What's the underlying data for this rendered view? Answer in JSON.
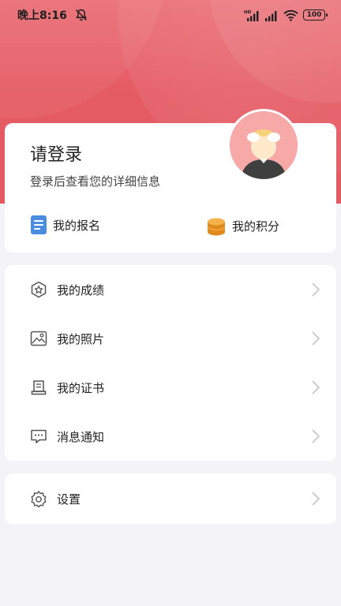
{
  "status_bar": {
    "time": "晚上8:16",
    "battery": "100"
  },
  "profile": {
    "login_title": "请登录",
    "login_subtitle": "登录后查看您的详细信息"
  },
  "quick_actions": [
    {
      "label": "我的报名",
      "icon": "document-icon"
    },
    {
      "label": "我的积分",
      "icon": "coins-icon"
    }
  ],
  "menu": [
    {
      "label": "我的成绩",
      "icon": "grade-badge-icon"
    },
    {
      "label": "我的照片",
      "icon": "photo-icon"
    },
    {
      "label": "我的证书",
      "icon": "certificate-icon"
    },
    {
      "label": "消息通知",
      "icon": "message-icon"
    }
  ],
  "settings": {
    "label": "设置",
    "icon": "gear-icon"
  },
  "colors": {
    "header_red": "#e55b64",
    "enroll_blue": "#4a8de0",
    "coins_orange": "#f0a030",
    "avatar_pink": "#f7a9a8"
  }
}
